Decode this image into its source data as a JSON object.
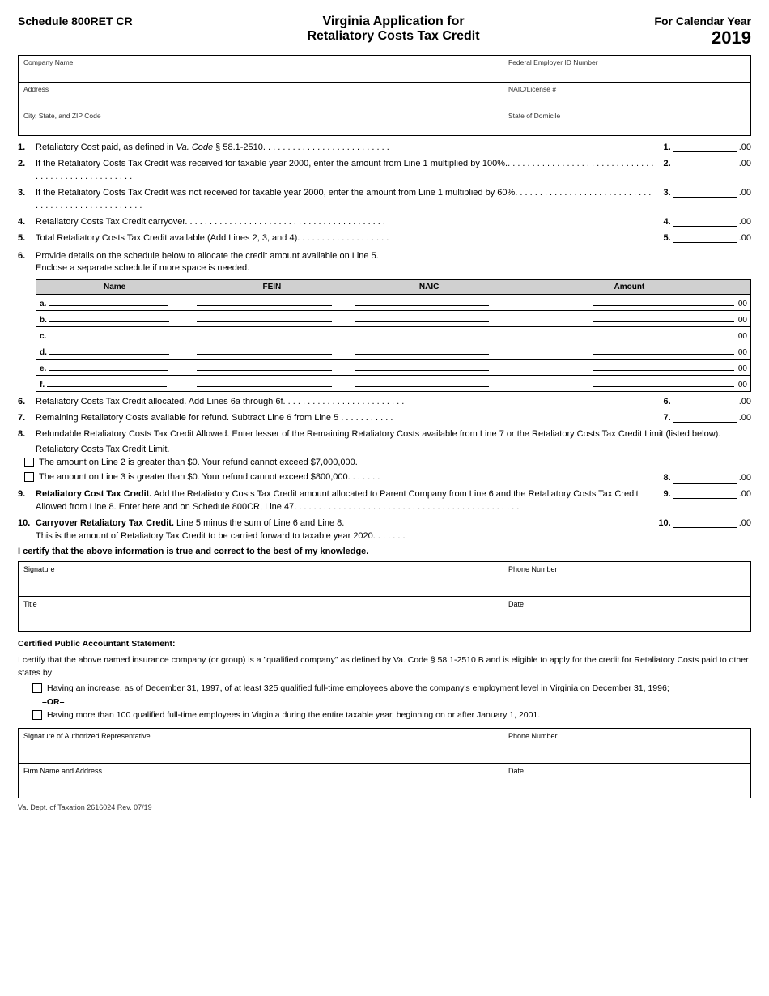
{
  "header": {
    "schedule": "Schedule 800RET CR",
    "title_line1": "Virginia Application for",
    "title_line2": "Retaliatory Costs Tax Credit",
    "for_label": "For Calendar Year",
    "year": "2019"
  },
  "form_fields": {
    "company_name_label": "Company Name",
    "federal_employer_label": "Federal Employer ID Number",
    "address_label": "Address",
    "naic_label": "NAIC/License #",
    "city_label": "City, State, and ZIP Code",
    "domicile_label": "State of Domicile"
  },
  "lines": [
    {
      "num": "1.",
      "text": "Retaliatory Cost paid, as defined in Va. Code § 58.1-2510. . . . . . . . . . . . . . . . . . . . . . . . . .",
      "result_num": "1.",
      "cents": ".00"
    },
    {
      "num": "2.",
      "text": "If the Retaliatory Costs Tax Credit was received for taxable year 2000, enter the amount from Line 1 multiplied by 100%.. . . . . . . . . . . . . . . . . . . . . . . . . . . . . . . . . . . . . . . . . . . . . . . . . .",
      "result_num": "2.",
      "cents": ".00"
    },
    {
      "num": "3.",
      "text": "If the Retaliatory Costs Tax Credit was not received for taxable year 2000, enter the amount from Line 1 multiplied by 60%.. . . . . . . . . . . . . . . . . . . . . . . . . . . . . . . . . . . . . . . . . . . . . . . . . .",
      "result_num": "3.",
      "cents": ".00"
    },
    {
      "num": "4.",
      "text": "Retaliatory Costs Tax Credit carryover. . . . . . . . . . . . . . . . . . . . . . . . . . . . . . . . . . . . . . . . .",
      "result_num": "4.",
      "cents": ".00"
    },
    {
      "num": "5.",
      "text": "Total Retaliatory Costs Tax Credit available (Add Lines 2, 3, and 4). . . . . . . . . . . . . . . . . . .",
      "result_num": "5.",
      "cents": ".00"
    }
  ],
  "line6_header": "6.",
  "line6_text": "Provide details on the schedule below to allocate the credit amount available on Line 5. Enclose a separate schedule if more space is needed.",
  "table_headers": {
    "name": "Name",
    "fein": "FEIN",
    "naic": "NAIC",
    "amount": "Amount"
  },
  "table_rows": [
    {
      "letter": "a.",
      "cents": ".00"
    },
    {
      "letter": "b.",
      "cents": ".00"
    },
    {
      "letter": "c.",
      "cents": ".00"
    },
    {
      "letter": "d.",
      "cents": ".00"
    },
    {
      "letter": "e.",
      "cents": ".00"
    },
    {
      "letter": "f.",
      "cents": ".00"
    }
  ],
  "line6b": {
    "num": "6.",
    "text": "Retaliatory Costs Tax Credit allocated. Add Lines 6a through 6f. . . . . . . . . . . . . . . . . . . . . . . . .",
    "result_num": "6.",
    "cents": ".00"
  },
  "line7": {
    "num": "7.",
    "text": "Remaining Retaliatory Costs available for refund. Subtract Line 6 from Line 5 . . . . . . . . . . .",
    "result_num": "7.",
    "cents": ".00"
  },
  "line8_header": "8.",
  "line8_text": "Refundable Retaliatory Costs Tax Credit Allowed. Enter lesser of the Remaining Retaliatory Costs available from Line 7 or the Retaliatory Costs Tax Credit Limit (listed below).",
  "line8_sublabel": "Retaliatory Costs Tax Credit Limit.",
  "line8_checkboxes": [
    {
      "text": "The amount on Line 2 is greater than $0. Your refund cannot exceed $7,000,000."
    },
    {
      "text": "The amount on Line 3 is greater than $0. Your refund cannot exceed $800,000.  . . . . . ."
    }
  ],
  "line8_result": {
    "result_num": "8.",
    "cents": ".00"
  },
  "line9": {
    "num": "9.",
    "text_bold": "Retaliatory Cost Tax Credit.",
    "text": " Add the Retaliatory Costs Tax Credit amount allocated to Parent Company from Line 6 and the Retaliatory Costs Tax Credit Allowed from Line 8. Enter here and on Schedule 800CR, Line 47. . . . . . . . . . . . . . . . . . . . . . . . . . . . . . . . . . . . . . . . . . . . . .",
    "result_num": "9.",
    "cents": ".00"
  },
  "line10": {
    "num": "10.",
    "text_bold": "Carryover Retaliatory Tax Credit.",
    "text": " Line 5 minus the sum of Line 6 and Line 8. This is the amount of Retaliatory Tax Credit to be carried forward to taxable year 2020. . . . . . .",
    "result_num": "10.",
    "cents": ".00"
  },
  "certify_line": "I certify that the above information is true and correct to the best of my knowledge.",
  "signature_label": "Signature",
  "phone_label": "Phone Number",
  "title_label": "Title",
  "date_label": "Date",
  "cpa_statement": {
    "heading": "Certified Public Accountant Statement:",
    "para1": "I certify that the above named insurance company (or group) is a \"qualified company\" as defined by Va. Code § 58.1-2510 B and is eligible to apply for the credit for Retaliatory Costs paid to other states by:",
    "checkbox1": "Having an increase, as of December 31, 1997, of at least 325 qualified full-time employees above the company's employment level in Virginia on December 31, 1996;",
    "or_label": "–OR–",
    "checkbox2": "Having more than 100 qualified full-time employees in Virginia during the entire taxable year, beginning on or after January 1, 2001."
  },
  "auth_signature_label": "Signature of Authorized Representative",
  "auth_phone_label": "Phone Number",
  "firm_label": "Firm Name and Address",
  "auth_date_label": "Date",
  "footer": "Va. Dept. of Taxation   2616024   Rev. 07/19"
}
